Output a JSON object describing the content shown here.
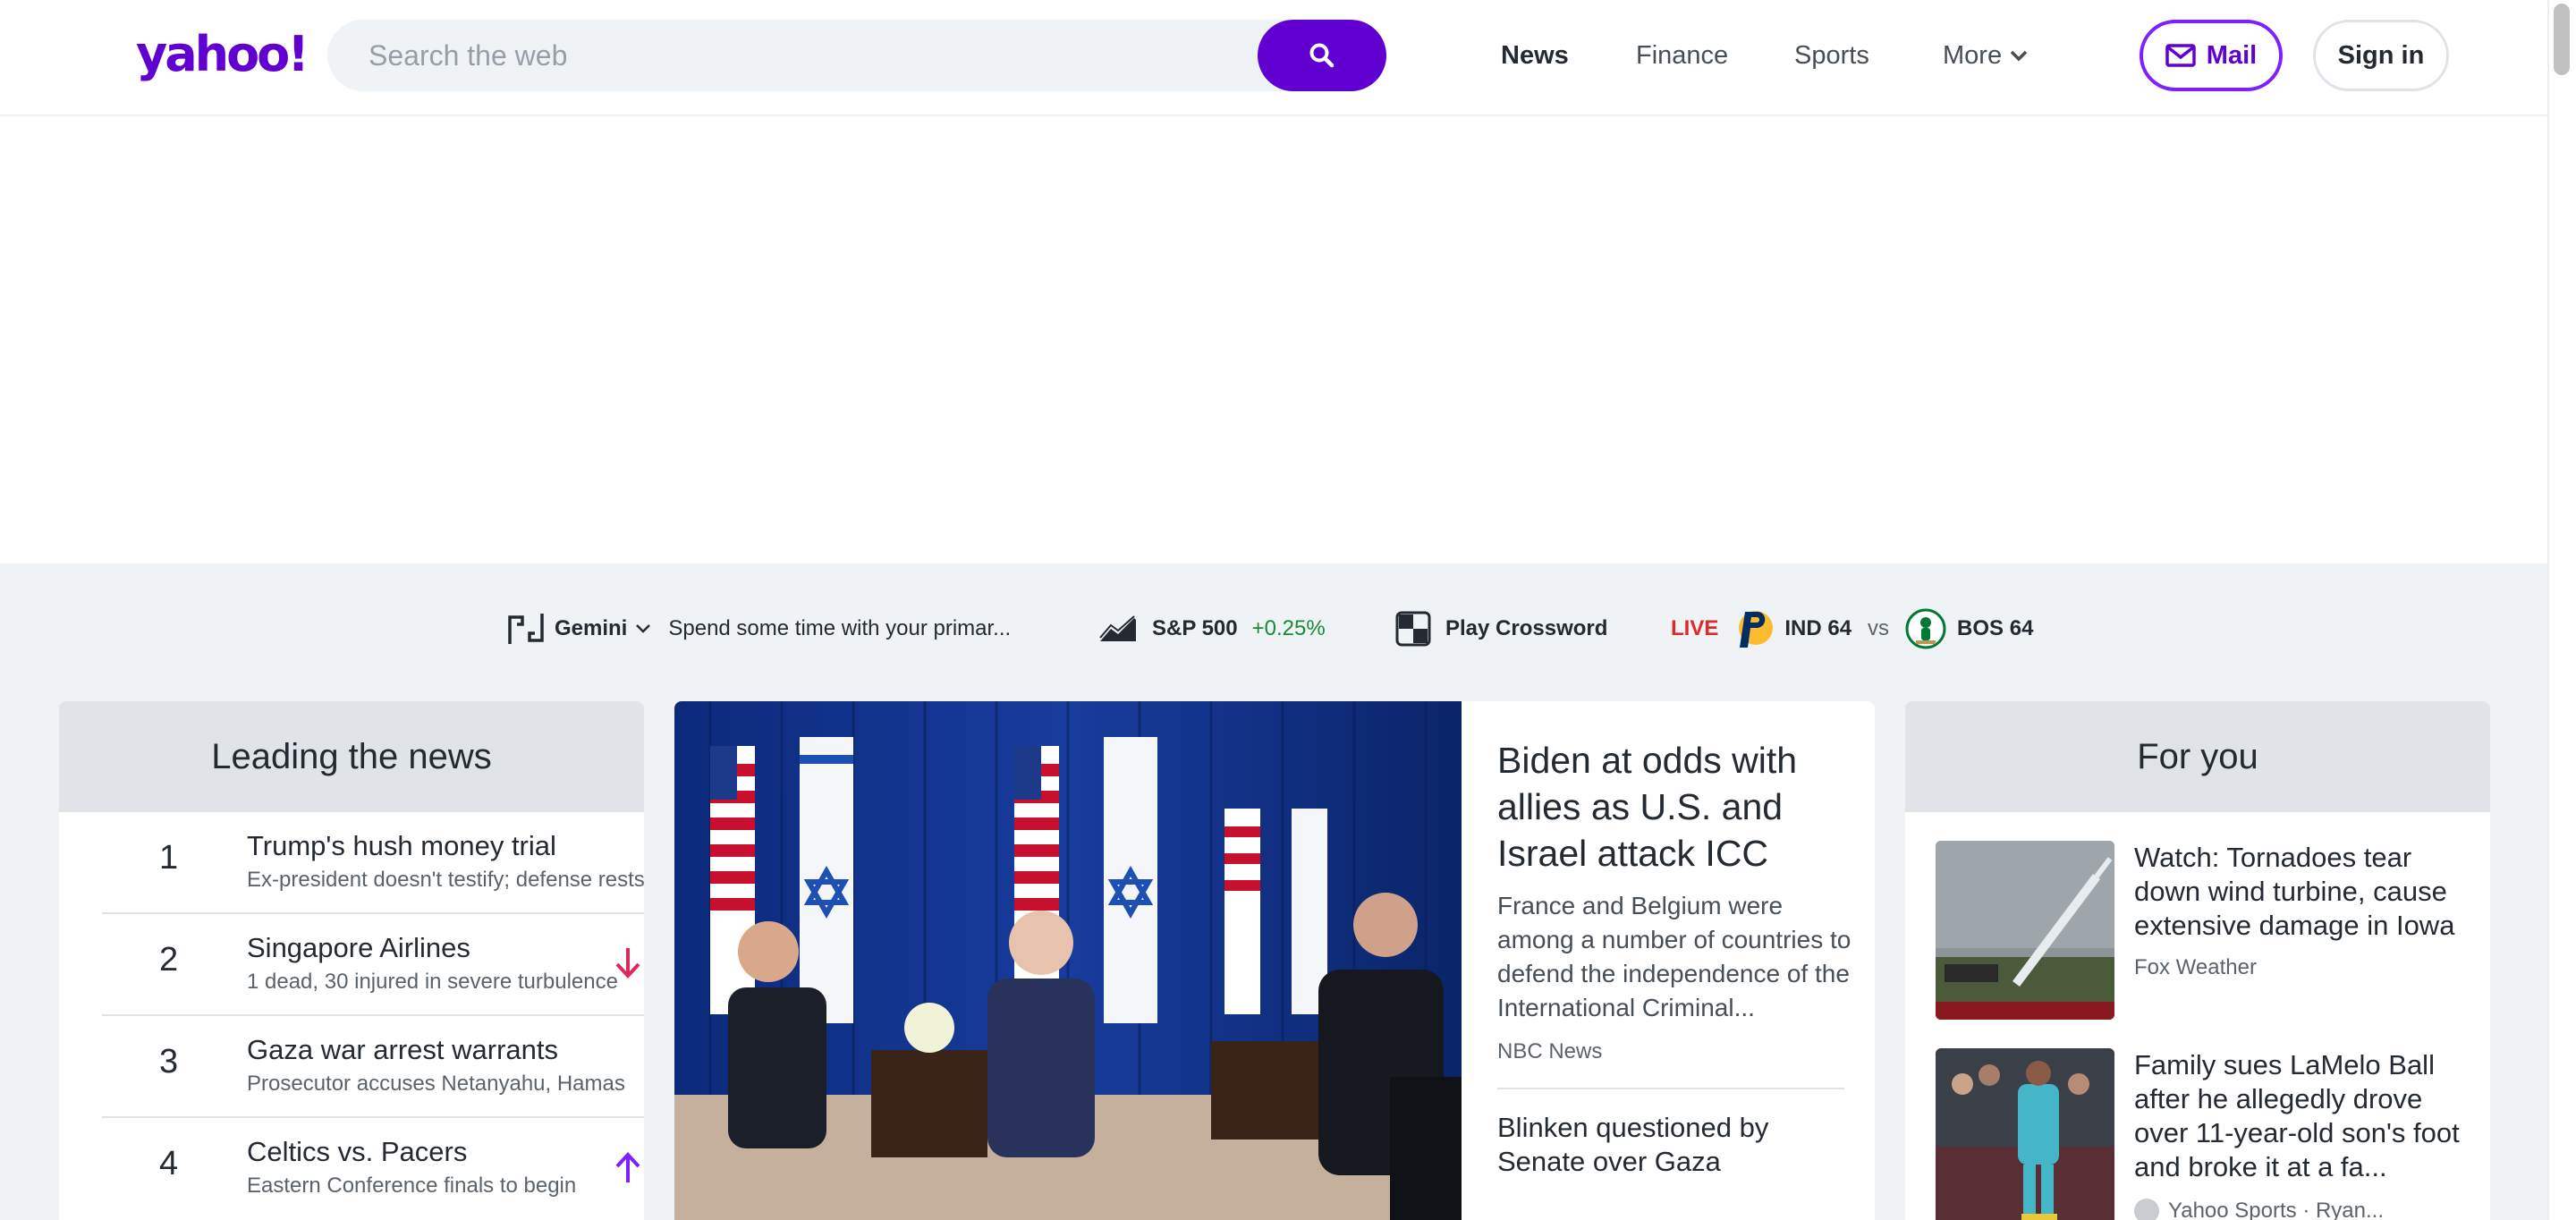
{
  "header": {
    "logo": "yahoo!",
    "search_placeholder": "Search the web",
    "nav": [
      "News",
      "Finance",
      "Sports",
      "More"
    ],
    "mail_label": "Mail",
    "signin_label": "Sign in"
  },
  "ticker": {
    "gemini_label": "Gemini",
    "gemini_text": "Spend some time with your primar...",
    "sp_label": "S&P 500",
    "sp_change": "+0.25%",
    "crossword_label": "Play Crossword",
    "live_label": "LIVE",
    "team1": "IND 64",
    "vs": "vs",
    "team2": "BOS 64"
  },
  "leading": {
    "title": "Leading the news",
    "items": [
      {
        "num": "1",
        "title": "Trump's hush money trial",
        "subtitle": "Ex-president doesn't testify; defense rests",
        "trend": ""
      },
      {
        "num": "2",
        "title": "Singapore Airlines",
        "subtitle": "1 dead, 30 injured in severe turbulence",
        "trend": "down"
      },
      {
        "num": "3",
        "title": "Gaza war arrest warrants",
        "subtitle": "Prosecutor accuses Netanyahu, Hamas",
        "trend": ""
      },
      {
        "num": "4",
        "title": "Celtics vs. Pacers",
        "subtitle": "Eastern Conference finals to begin",
        "trend": "up"
      }
    ]
  },
  "hero": {
    "title": "Biden at odds with allies as U.S. and Israel attack ICC",
    "summary": "France and Belgium were among a number of countries to defend the independence of the International Criminal...",
    "source": "NBC News",
    "second_title": "Blinken questioned by Senate over Gaza"
  },
  "foryou": {
    "title": "For you",
    "items": [
      {
        "title": "Watch: Tornadoes tear down wind turbine, cause extensive damage in Iowa",
        "source": "Fox Weather"
      },
      {
        "title": "Family sues LaMelo Ball after he allegedly drove over 11-year-old son's foot and broke it at a fa...",
        "source": "Yahoo Sports · Ryan..."
      }
    ]
  },
  "colors": {
    "brand": "#6001d2",
    "accent_border": "#7e1fff",
    "positive": "#1a8a3a",
    "live": "#e0292b",
    "down_arrow": "#e0295b",
    "up_arrow": "#7e1fff"
  },
  "icons": [
    "search-icon",
    "chevron-down-icon",
    "mail-icon",
    "gemini-icon",
    "stock-chart-icon",
    "crossword-icon",
    "pacers-logo-icon",
    "celtics-logo-icon",
    "arrow-down-icon",
    "arrow-up-icon"
  ]
}
